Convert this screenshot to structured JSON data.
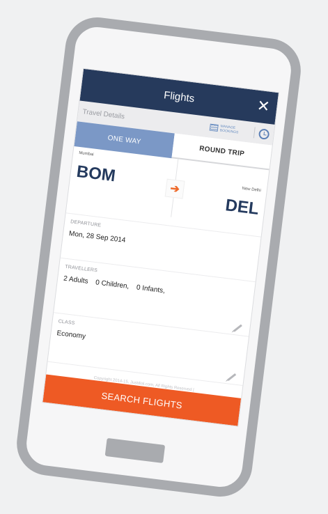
{
  "app": {
    "title": "Flights",
    "close_icon": "close-icon"
  },
  "travel_details": {
    "title": "Travel Details",
    "manage_label": "MANAGE BOOKINGS",
    "history_icon": "history-icon"
  },
  "tabs": [
    {
      "label": "ONE WAY",
      "active": true
    },
    {
      "label": "ROUND TRIP",
      "active": false
    }
  ],
  "route": {
    "from_city": "Mumbai",
    "from_code": "BOM",
    "to_city": "New Delhi",
    "to_code": "DEL",
    "swap_icon": "arrow-right-icon"
  },
  "departure": {
    "label": "DEPARTURE",
    "value": "Mon, 28 Sep 2014"
  },
  "travellers": {
    "label": "TRAVELLERS",
    "adults": "2 Adults",
    "children": "0 Children,",
    "infants": "0 Infants,",
    "edit_icon": "pencil-icon"
  },
  "class": {
    "label": "CLASS",
    "value": "Economy",
    "edit_icon": "pencil-icon"
  },
  "footer": {
    "copyright": "Copyright 2014-15, Justdial.com, All Rights Reserved |",
    "terms": "Terms"
  },
  "search_button": {
    "label": "SEARCH FLIGHTS"
  },
  "colors": {
    "header": "#263a5c",
    "active_tab": "#7b98c6",
    "accent": "#ee5a24",
    "device_frame": "#a9abaf"
  }
}
